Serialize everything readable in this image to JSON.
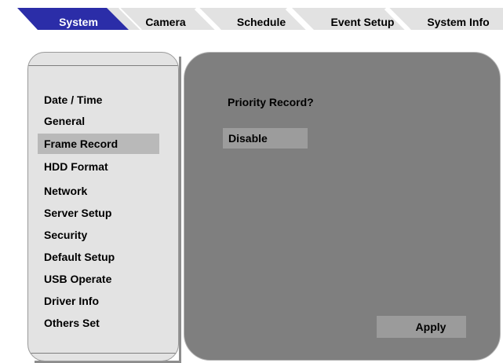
{
  "tabs": [
    {
      "label": "System",
      "active": true
    },
    {
      "label": "Camera",
      "active": false
    },
    {
      "label": "Schedule",
      "active": false
    },
    {
      "label": "Event Setup",
      "active": false
    },
    {
      "label": "System Info",
      "active": false
    }
  ],
  "sidebar": {
    "items": [
      {
        "label": "Date / Time",
        "selected": false
      },
      {
        "label": "General",
        "selected": false
      },
      {
        "label": "Frame Record",
        "selected": true
      },
      {
        "label": "HDD Format",
        "selected": false
      },
      {
        "label": "Network",
        "selected": false
      },
      {
        "label": "Server Setup",
        "selected": false
      },
      {
        "label": "Security",
        "selected": false
      },
      {
        "label": "Default Setup",
        "selected": false
      },
      {
        "label": "USB Operate",
        "selected": false
      },
      {
        "label": "Driver Info",
        "selected": false
      },
      {
        "label": "Others Set",
        "selected": false
      }
    ]
  },
  "main": {
    "title": "Priority Record?",
    "value": "Disable",
    "apply_label": "Apply"
  },
  "colors": {
    "active_tab": "#2b2da8",
    "inactive_tab": "#e2e2e2",
    "panel_bg": "#7f7f7f",
    "sidebar_bg": "#e3e3e3",
    "selected_item": "#b9b9b9"
  }
}
